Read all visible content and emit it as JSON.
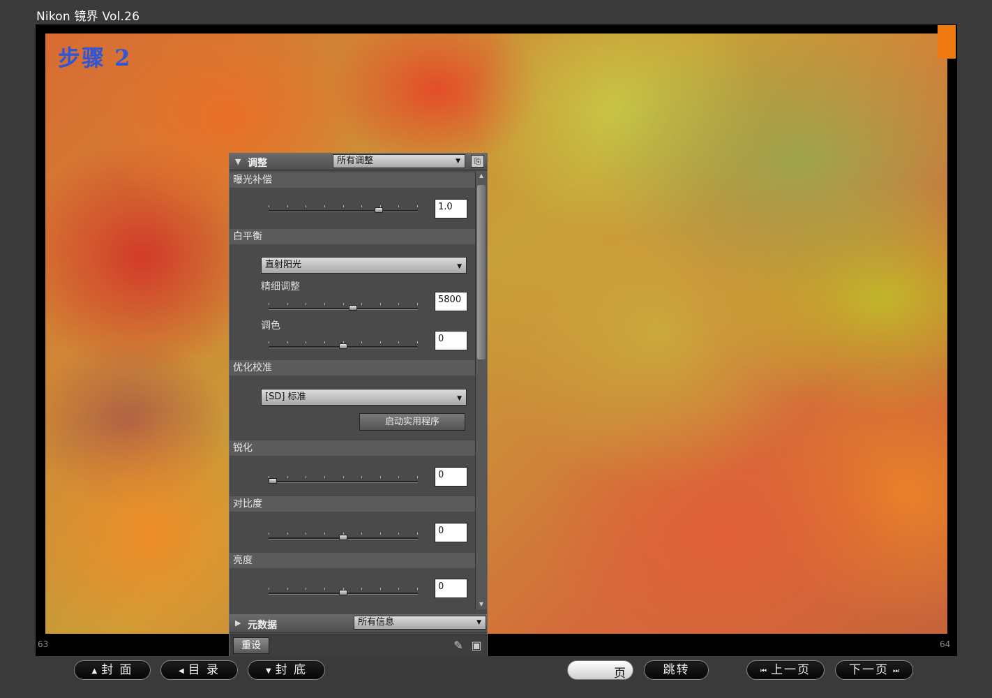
{
  "app": {
    "title": "Nikon 镜界 Vol.26"
  },
  "viewer": {
    "step_label": "步骤 2",
    "page_left": "63",
    "page_right": "64",
    "accent_color": "#ef7a12"
  },
  "panel": {
    "header": {
      "title": "调整",
      "selector": "所有调整",
      "reset_icon": "copy-reset-icon"
    },
    "sections": {
      "exposure": {
        "label": "曝光补偿",
        "value": "1.0",
        "slider_fraction": 0.75
      },
      "white_balance": {
        "label": "白平衡",
        "preset": "直射阳光",
        "fine_tune_label": "精细调整",
        "fine_tune_value": "5800",
        "fine_tune_fraction": 0.57,
        "tint_label": "调色",
        "tint_value": "0",
        "tint_fraction": 0.5
      },
      "picture_control": {
        "label": "优化校准",
        "preset": "[SD] 标准",
        "utility_button": "启动实用程序"
      },
      "sharpening": {
        "label": "锐化",
        "value": "0",
        "slider_fraction": 0.0
      },
      "contrast": {
        "label": "对比度",
        "value": "0",
        "slider_fraction": 0.5
      },
      "brightness": {
        "label": "亮度",
        "value": "0",
        "slider_fraction": 0.5
      }
    },
    "metadata": {
      "title": "元数据",
      "selector": "所有信息"
    },
    "footer": {
      "reset_label": "重设",
      "icons": [
        "apply-settings-icon",
        "save-icon"
      ]
    }
  },
  "nav": {
    "cover": "封 面",
    "toc": "目 录",
    "back_cover": "封 底",
    "page_field_label": "页",
    "jump": "跳转",
    "prev": "上一页",
    "next": "下一页"
  }
}
